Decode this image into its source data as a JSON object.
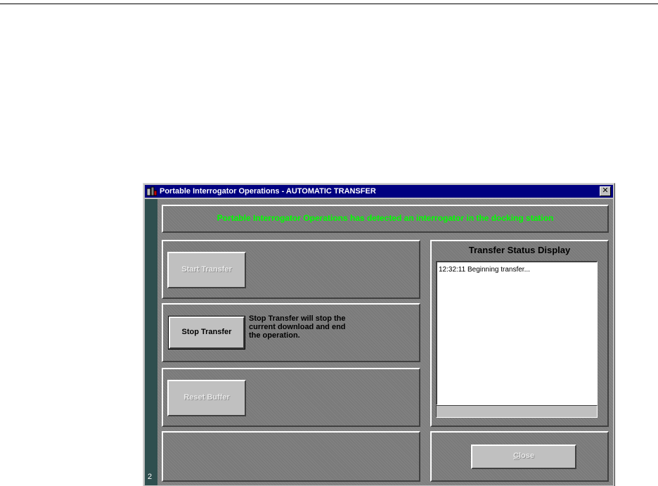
{
  "window": {
    "title": "Portable Interrogator Operations  -  AUTOMATIC TRANSFER",
    "close_glyph": "✕",
    "side_number": "2"
  },
  "banner": {
    "message": "Portable Interrogator Operations has detected an interrogator in the docking station",
    "color": "#00ff00"
  },
  "actions": {
    "start_transfer_label": "Start Transfer",
    "stop_transfer_label": "Stop Transfer",
    "stop_transfer_description": "Stop Transfer will stop the current download and end the operation.",
    "reset_buffer_label": "Reset Buffer"
  },
  "status": {
    "title": "Transfer Status Display",
    "lines": [
      "12:32:11 Beginning transfer..."
    ]
  },
  "footer": {
    "close_label_mnemonic": "C",
    "close_label_rest": "lose"
  },
  "colors": {
    "titlebar": "#000080",
    "side_strip": "#2f4f4f",
    "panel": "#7a7a7a"
  }
}
